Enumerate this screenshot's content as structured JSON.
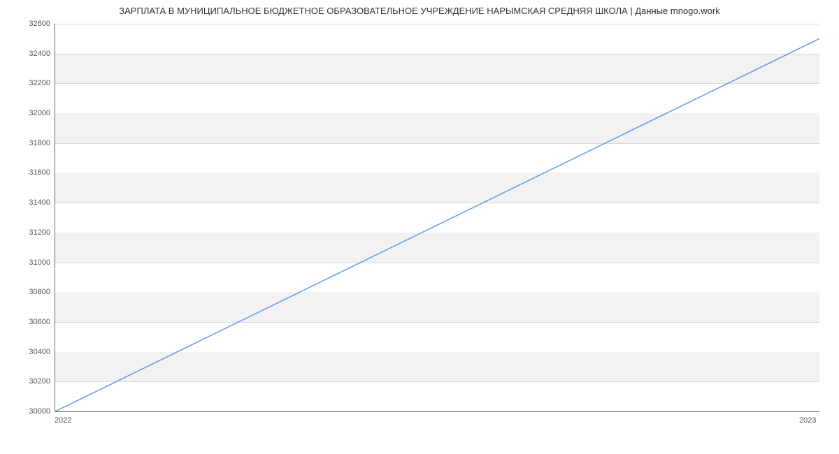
{
  "chart_data": {
    "type": "line",
    "title": "ЗАРПЛАТА В МУНИЦИПАЛЬНОЕ БЮДЖЕТНОЕ ОБРАЗОВАТЕЛЬНОЕ УЧРЕЖДЕНИЕ НАРЫМСКАЯ СРЕДНЯЯ ШКОЛА | Данные mnogo.work",
    "x": [
      2022,
      2023
    ],
    "values": [
      30000,
      32500
    ],
    "xlabel": "",
    "ylabel": "",
    "xlim": [
      2022,
      2023
    ],
    "ylim": [
      30000,
      32600
    ],
    "y_ticks": [
      30000,
      30200,
      30400,
      30600,
      30800,
      31000,
      31200,
      31400,
      31600,
      31800,
      32000,
      32200,
      32400,
      32600
    ],
    "x_ticks": [
      2022,
      2023
    ]
  }
}
